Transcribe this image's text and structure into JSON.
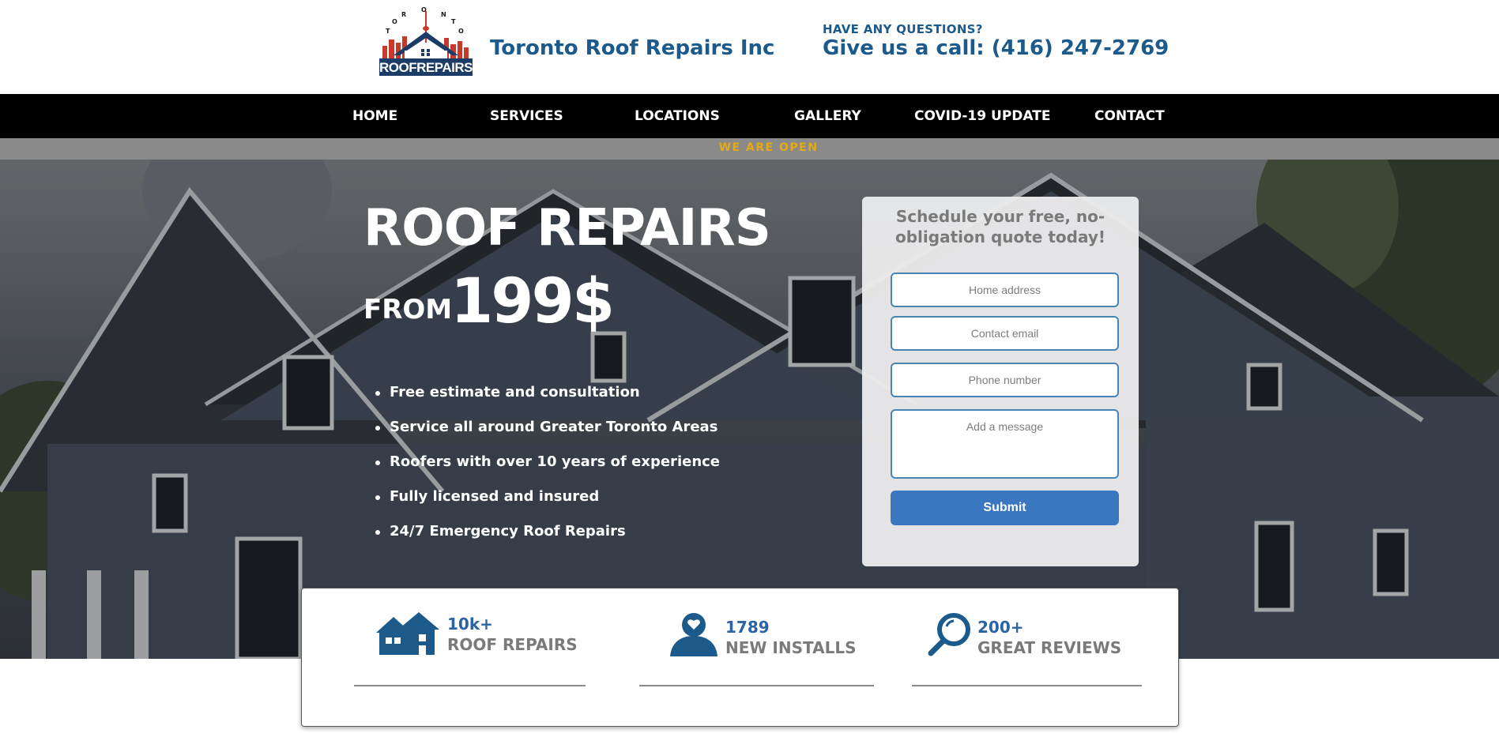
{
  "header": {
    "brand_name": "Toronto Roof Repairs Inc",
    "logo_text": "ROOFREPAIRS",
    "logo_arc_text": "TORONTO",
    "questions_label": "HAVE ANY QUESTIONS?",
    "call_text": "Give us a call: (416) 247-2769"
  },
  "nav": {
    "items": [
      {
        "label": "HOME"
      },
      {
        "label": "SERVICES"
      },
      {
        "label": "LOCATIONS"
      },
      {
        "label": "GALLERY"
      },
      {
        "label": "COVID-19 UPDATE"
      },
      {
        "label": "CONTACT"
      }
    ]
  },
  "banner": {
    "text": "WE ARE OPEN"
  },
  "hero": {
    "title": "ROOF REPAIRS",
    "from_label": "FROM",
    "price": "199$",
    "features": [
      "Free estimate and consultation",
      "Service all around Greater Toronto Areas",
      "Roofers with over 10 years of experience",
      "Fully licensed and insured",
      "24/7 Emergency Roof Repairs"
    ]
  },
  "quote_form": {
    "title": "Schedule your free, no-obligation quote today!",
    "address_placeholder": "Home address",
    "email_placeholder": "Contact email",
    "phone_placeholder": "Phone number",
    "message_placeholder": "Add a message",
    "submit_label": "Submit"
  },
  "stats": [
    {
      "number": "10k+",
      "label": "ROOF REPAIRS",
      "icon": "houses-icon"
    },
    {
      "number": "1789",
      "label": "NEW INSTALLS",
      "icon": "user-heart-icon"
    },
    {
      "number": "200+",
      "label": "GREAT REVIEWS",
      "icon": "magnifier-icon"
    }
  ],
  "colors": {
    "brand_blue": "#1b5a8a",
    "button_blue": "#3a77c0",
    "open_yellow": "#e5a915",
    "nav_black": "#000000"
  }
}
